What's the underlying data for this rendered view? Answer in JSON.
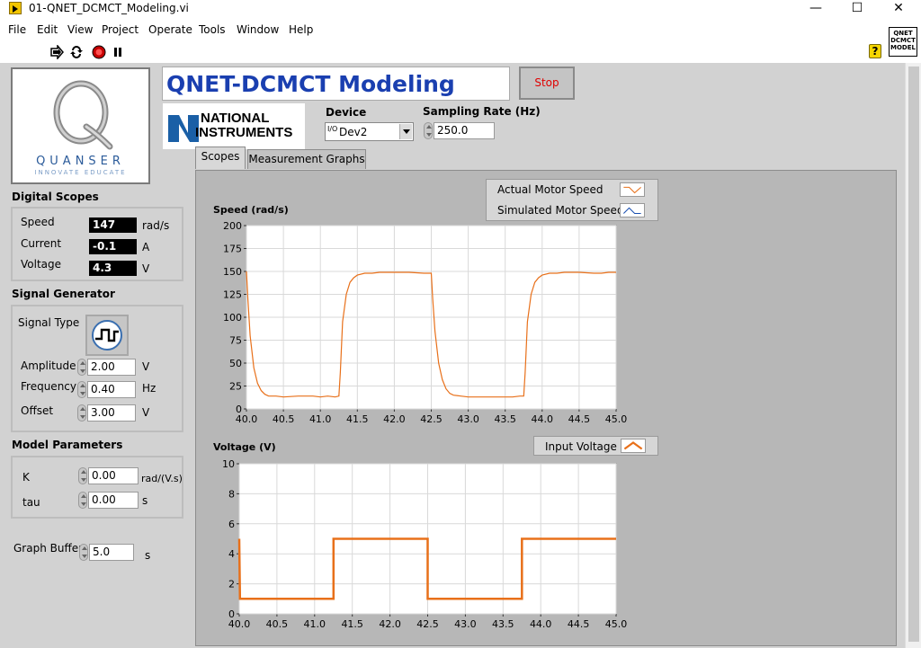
{
  "window": {
    "title": "01-QNET_DCMCT_Modeling.vi",
    "minimize": "—",
    "maximize": "☐",
    "close": "✕"
  },
  "menu": [
    "File",
    "Edit",
    "View",
    "Project",
    "Operate",
    "Tools",
    "Window",
    "Help"
  ],
  "toolbar": {
    "icons": [
      "run-arrow-icon",
      "run-continuous-icon",
      "abort-icon",
      "pause-icon"
    ]
  },
  "help_icon": "?",
  "vi_icon": {
    "lines": [
      "QNET",
      "DCMCT",
      "MODEL"
    ]
  },
  "header": {
    "title": "QNET-DCMCT Modeling",
    "stop_label": "Stop"
  },
  "ni_logo": {
    "line1": "NATIONAL",
    "line2": "INSTRUMENTS"
  },
  "logo": {
    "name": "QUANSER",
    "tagline": "INNOVATE EDUCATE"
  },
  "device": {
    "label": "Device",
    "prefix": "I/O",
    "value": "Dev2"
  },
  "sampling": {
    "label": "Sampling Rate (Hz)",
    "value": "250.0"
  },
  "digital_scopes": {
    "title": "Digital Scopes",
    "rows": [
      {
        "label": "Speed",
        "value": "147",
        "unit": "rad/s"
      },
      {
        "label": "Current",
        "value": "-0.1",
        "unit": "A"
      },
      {
        "label": "Voltage",
        "value": "4.3",
        "unit": "V"
      }
    ]
  },
  "signal_generator": {
    "title": "Signal Generator",
    "signal_type_label": "Signal Type",
    "rows": [
      {
        "label": "Amplitude",
        "value": "2.00",
        "unit": "V"
      },
      {
        "label": "Frequency",
        "value": "0.40",
        "unit": "Hz"
      },
      {
        "label": "Offset",
        "value": "3.00",
        "unit": "V"
      }
    ]
  },
  "model_params": {
    "title": "Model Parameters",
    "rows": [
      {
        "label": "K",
        "value": "0.00",
        "unit": "rad/(V.s)"
      },
      {
        "label": "tau",
        "value": "0.00",
        "unit": "s"
      }
    ]
  },
  "graph_buffer": {
    "label": "Graph Buffer",
    "value": "5.0",
    "unit": "s"
  },
  "tabs": [
    {
      "label": "Scopes",
      "active": true
    },
    {
      "label": "Measurement Graphs",
      "active": false
    }
  ],
  "speed_chart": {
    "title": "Speed (rad/s)",
    "legend": [
      {
        "name": "Actual Motor Speed",
        "color": "#e8701a"
      },
      {
        "name": "Simulated Motor Speed",
        "color": "#1a4fb0"
      }
    ]
  },
  "voltage_chart": {
    "title": "Voltage (V)",
    "legend": [
      {
        "name": "Input Voltage",
        "color": "#e8701a"
      }
    ]
  },
  "chart_data": [
    {
      "type": "line",
      "title": "Speed (rad/s)",
      "xlabel": "",
      "ylabel": "",
      "xlim": [
        40.0,
        45.0
      ],
      "ylim": [
        0,
        200
      ],
      "x_ticks": [
        "40.0",
        "40.5",
        "41.0",
        "41.5",
        "42.0",
        "42.5",
        "43.0",
        "43.5",
        "44.0",
        "44.5",
        "45.0"
      ],
      "y_ticks": [
        "0",
        "25",
        "50",
        "75",
        "100",
        "125",
        "150",
        "175",
        "200"
      ],
      "grid": true,
      "series": [
        {
          "name": "Actual Motor Speed",
          "color": "#e8701a",
          "x": [
            40.0,
            40.02,
            40.05,
            40.1,
            40.15,
            40.2,
            40.25,
            40.3,
            40.4,
            40.5,
            40.7,
            40.9,
            41.0,
            41.1,
            41.2,
            41.25,
            41.27,
            41.3,
            41.35,
            41.4,
            41.45,
            41.5,
            41.6,
            41.7,
            41.8,
            42.0,
            42.2,
            42.4,
            42.5,
            42.52,
            42.55,
            42.6,
            42.65,
            42.7,
            42.75,
            42.8,
            42.9,
            43.0,
            43.2,
            43.4,
            43.6,
            43.7,
            43.75,
            43.77,
            43.8,
            43.85,
            43.9,
            43.95,
            44.0,
            44.1,
            44.2,
            44.3,
            44.5,
            44.7,
            44.8,
            44.9,
            45.0
          ],
          "y": [
            150,
            120,
            80,
            45,
            28,
            20,
            16,
            14,
            14,
            13,
            14,
            14,
            13,
            14,
            13,
            14,
            40,
            95,
            125,
            138,
            143,
            146,
            148,
            148,
            149,
            149,
            149,
            148,
            148,
            120,
            85,
            50,
            32,
            22,
            17,
            15,
            14,
            13,
            13,
            13,
            13,
            14,
            14,
            40,
            95,
            125,
            138,
            143,
            146,
            148,
            148,
            149,
            149,
            148,
            148,
            149,
            149
          ]
        },
        {
          "name": "Simulated Motor Speed",
          "color": "#1a4fb0",
          "x": [],
          "y": []
        }
      ]
    },
    {
      "type": "line",
      "title": "Voltage (V)",
      "xlabel": "",
      "ylabel": "",
      "xlim": [
        40.0,
        45.0
      ],
      "ylim": [
        0,
        10
      ],
      "x_ticks": [
        "40.0",
        "40.5",
        "41.0",
        "41.5",
        "42.0",
        "42.5",
        "43.0",
        "43.5",
        "44.0",
        "44.5",
        "45.0"
      ],
      "y_ticks": [
        "0",
        "2",
        "4",
        "6",
        "8",
        "10"
      ],
      "grid": true,
      "series": [
        {
          "name": "Input Voltage",
          "color": "#e8701a",
          "x": [
            40.0,
            40.0,
            40.01,
            41.25,
            41.25,
            42.5,
            42.5,
            43.75,
            43.75,
            45.0
          ],
          "y": [
            5,
            5,
            1,
            1,
            5,
            5,
            1,
            1,
            5,
            5
          ]
        }
      ]
    }
  ]
}
